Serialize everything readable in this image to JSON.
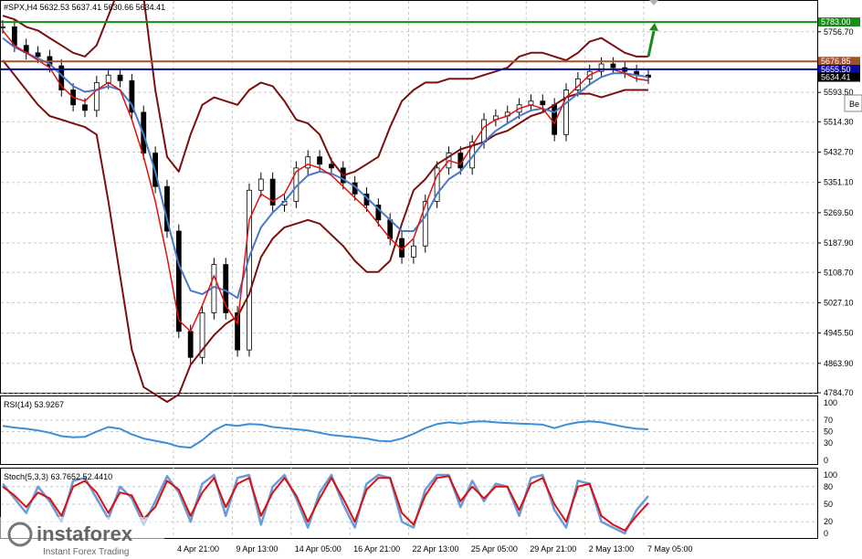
{
  "header": {
    "symbol_line": "#SPX,H4  5632.53 5637.41 5630.66 5634.41"
  },
  "colors": {
    "bollinger": "#7a1010",
    "ma_fast": "#e01010",
    "ma_slow": "#4a78c8",
    "rsi": "#3a8fd8",
    "stoch_k": "#6a9ad8",
    "stoch_d": "#d81010",
    "green_level": "#1a8a1a",
    "brown_level": "#a0522d",
    "blue_level": "#0a0aa0",
    "bull_candle": "#000000"
  },
  "badge": {
    "text": "Be"
  },
  "watermark": {
    "brand": "instaforex",
    "tagline": "Instant Forex Trading"
  },
  "chart_data": [
    {
      "type": "line",
      "name": "price",
      "ylim": [
        4784.7,
        5825
      ],
      "y_ticks": [
        "5756.70",
        "5676.85",
        "5593.50",
        "5514.30",
        "5432.70",
        "5351.10",
        "5269.50",
        "5187.90",
        "5108.70",
        "5027.10",
        "4945.50",
        "4863.90",
        "4784.70"
      ],
      "x_labels": [
        "4 Apr 21:00",
        "9 Apr 13:00",
        "14 Apr 05:00",
        "16 Apr 21:00",
        "22 Apr 13:00",
        "25 Apr 05:00",
        "29 Apr 21:00",
        "2 May 13:00",
        "7 May 05:00"
      ],
      "levels": [
        {
          "label": "5783.00",
          "value": 5783.0,
          "color": "#1a8a1a"
        },
        {
          "label": "5676.85",
          "value": 5676.85,
          "color": "#a0522d"
        },
        {
          "label": "5655.50",
          "value": 5655.5,
          "color": "#0a0aa0"
        },
        {
          "label": "5634.41",
          "value": 5634.41,
          "color": "#000000"
        }
      ],
      "close_series": [
        5770,
        5720,
        5700,
        5690,
        5665,
        5600,
        5560,
        5545,
        5620,
        5640,
        5625,
        5540,
        5430,
        5340,
        5220,
        4950,
        4880,
        5000,
        5130,
        5000,
        4900,
        5330,
        5360,
        5290,
        5300,
        5390,
        5420,
        5400,
        5390,
        5350,
        5320,
        5290,
        5250,
        5200,
        5150,
        5180,
        5300,
        5390,
        5430,
        5390,
        5460,
        5520,
        5530,
        5540,
        5560,
        5570,
        5560,
        5480,
        5600,
        5630,
        5650,
        5670,
        5660,
        5650,
        5640,
        5634
      ],
      "bb_upper": [
        5800,
        5790,
        5770,
        5760,
        5740,
        5720,
        5700,
        5690,
        5720,
        5800,
        5880,
        5890,
        5850,
        5600,
        5420,
        5380,
        5480,
        5560,
        5580,
        5570,
        5560,
        5600,
        5620,
        5610,
        5570,
        5520,
        5510,
        5480,
        5410,
        5370,
        5380,
        5400,
        5420,
        5500,
        5570,
        5600,
        5620,
        5620,
        5630,
        5630,
        5630,
        5640,
        5650,
        5660,
        5690,
        5700,
        5700,
        5690,
        5680,
        5700,
        5730,
        5740,
        5720,
        5700,
        5690,
        5690
      ],
      "bb_lower": [
        5680,
        5640,
        5600,
        5560,
        5530,
        5520,
        5510,
        5500,
        5480,
        5300,
        5100,
        4900,
        4800,
        4780,
        4760,
        4780,
        4860,
        4900,
        4940,
        4970,
        4990,
        5050,
        5150,
        5200,
        5230,
        5240,
        5250,
        5240,
        5210,
        5180,
        5140,
        5110,
        5110,
        5140,
        5240,
        5330,
        5360,
        5400,
        5420,
        5440,
        5450,
        5460,
        5480,
        5490,
        5510,
        5530,
        5540,
        5560,
        5580,
        5590,
        5590,
        5580,
        5590,
        5600,
        5600,
        5600
      ],
      "ma_fast": [
        5760,
        5720,
        5700,
        5680,
        5660,
        5610,
        5580,
        5570,
        5600,
        5620,
        5600,
        5520,
        5420,
        5300,
        5150,
        4980,
        4950,
        5020,
        5100,
        5020,
        4970,
        5250,
        5320,
        5300,
        5320,
        5380,
        5400,
        5390,
        5370,
        5340,
        5310,
        5280,
        5240,
        5200,
        5170,
        5200,
        5290,
        5370,
        5410,
        5400,
        5450,
        5500,
        5520,
        5530,
        5550,
        5560,
        5550,
        5510,
        5580,
        5610,
        5640,
        5655,
        5655,
        5645,
        5630,
        5625
      ],
      "ma_slow": [
        5740,
        5715,
        5700,
        5685,
        5670,
        5640,
        5610,
        5595,
        5600,
        5610,
        5600,
        5560,
        5480,
        5380,
        5250,
        5130,
        5060,
        5050,
        5070,
        5060,
        5040,
        5150,
        5230,
        5270,
        5300,
        5340,
        5370,
        5380,
        5375,
        5360,
        5340,
        5310,
        5280,
        5250,
        5220,
        5220,
        5260,
        5320,
        5360,
        5380,
        5420,
        5460,
        5490,
        5510,
        5530,
        5545,
        5550,
        5540,
        5565,
        5590,
        5615,
        5635,
        5645,
        5645,
        5640,
        5635
      ]
    },
    {
      "type": "line",
      "name": "RSI(14)",
      "title": "RSI(14) 53.9267",
      "ylim": [
        0,
        100
      ],
      "y_ticks": [
        "100",
        "70",
        "50",
        "30",
        "0"
      ],
      "levels": [
        70,
        50,
        30
      ],
      "values": [
        60,
        57,
        55,
        52,
        48,
        42,
        40,
        41,
        50,
        58,
        55,
        45,
        38,
        34,
        30,
        24,
        22,
        35,
        52,
        62,
        60,
        63,
        62,
        58,
        56,
        54,
        52,
        48,
        44,
        42,
        40,
        38,
        34,
        33,
        38,
        46,
        56,
        63,
        66,
        64,
        67,
        68,
        66,
        65,
        64,
        63,
        62,
        56,
        62,
        66,
        68,
        66,
        62,
        58,
        55,
        54
      ]
    },
    {
      "type": "line",
      "name": "Stoch(5,3,3)",
      "title": "Stoch(5,3,3) 63.7652 52.4410",
      "ylim": [
        0,
        100
      ],
      "y_ticks": [
        "100",
        "80",
        "50",
        "20",
        "0"
      ],
      "levels": [
        80,
        50,
        20
      ],
      "k_values": [
        85,
        60,
        35,
        80,
        55,
        20,
        90,
        95,
        60,
        25,
        80,
        60,
        15,
        55,
        98,
        70,
        20,
        85,
        100,
        30,
        95,
        100,
        15,
        80,
        100,
        60,
        10,
        70,
        100,
        50,
        10,
        85,
        100,
        95,
        20,
        10,
        75,
        100,
        100,
        45,
        90,
        55,
        85,
        80,
        30,
        95,
        100,
        40,
        10,
        90,
        85,
        20,
        10,
        0,
        40,
        64
      ],
      "d_values": [
        80,
        65,
        45,
        70,
        60,
        30,
        80,
        90,
        70,
        35,
        70,
        65,
        25,
        45,
        90,
        75,
        30,
        70,
        95,
        45,
        85,
        95,
        30,
        70,
        95,
        65,
        20,
        60,
        95,
        60,
        20,
        75,
        95,
        95,
        35,
        15,
        65,
        95,
        98,
        55,
        80,
        60,
        80,
        80,
        40,
        85,
        95,
        50,
        20,
        80,
        85,
        30,
        15,
        5,
        30,
        52
      ]
    }
  ]
}
